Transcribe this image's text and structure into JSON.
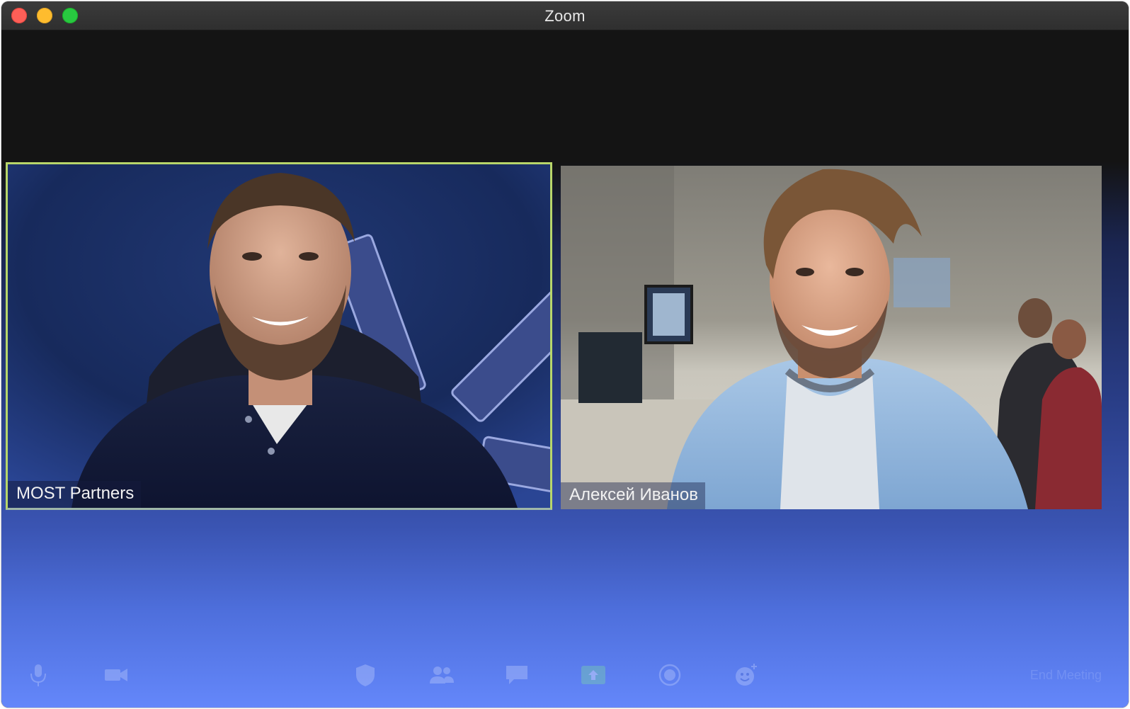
{
  "window": {
    "title": "Zoom"
  },
  "participants": [
    {
      "name": "MOST Partners",
      "active_speaker": true
    },
    {
      "name": "Алексей Иванов",
      "active_speaker": false
    }
  ],
  "toolbar": {
    "end_meeting_label": "End Meeting",
    "icons": [
      "microphone-icon",
      "video-camera-icon",
      "security-shield-icon",
      "participants-icon",
      "chat-icon",
      "share-screen-icon",
      "record-icon",
      "reactions-icon"
    ]
  },
  "colors": {
    "active_speaker_border": "#b8d66a",
    "traffic_red": "#fe5f57",
    "traffic_yellow": "#febc2e",
    "traffic_green": "#28c840"
  }
}
